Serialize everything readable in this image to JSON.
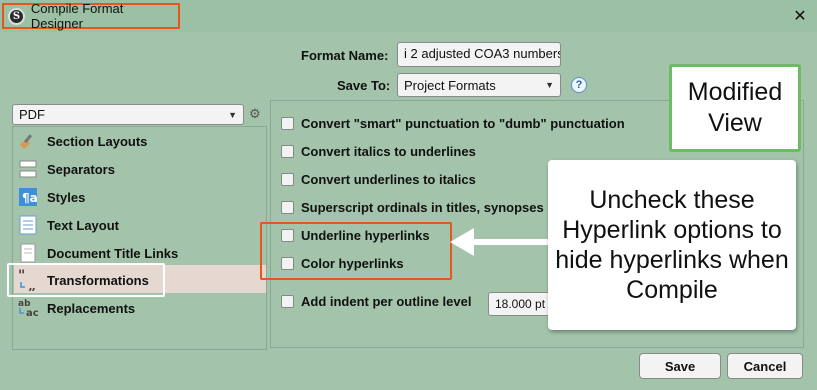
{
  "window": {
    "title": "Compile Format Designer",
    "close_glyph": "✕",
    "app_icon_letter": "S"
  },
  "header": {
    "format_name_label": "Format Name:",
    "format_name_value": "i 2 adjusted COA3 numbers",
    "save_to_label": "Save To:",
    "save_to_value": "Project Formats",
    "help_glyph": "?"
  },
  "left": {
    "output_type": "PDF",
    "gear_glyph": "⚙",
    "items": [
      {
        "label": "Section Layouts",
        "icon": "paintbrush-icon"
      },
      {
        "label": "Separators",
        "icon": "separator-icon"
      },
      {
        "label": "Styles",
        "icon": "styles-icon"
      },
      {
        "label": "Text Layout",
        "icon": "text-layout-icon"
      },
      {
        "label": "Document Title Links",
        "icon": "document-icon"
      },
      {
        "label": "Transformations",
        "icon": "quote-transform-icon"
      },
      {
        "label": "Replacements",
        "icon": "ab-ac-replace-icon"
      }
    ],
    "selected": "Transformations"
  },
  "options": [
    {
      "label": "Convert \"smart\" punctuation to \"dumb\" punctuation",
      "checked": false
    },
    {
      "label": "Convert italics to underlines",
      "checked": false
    },
    {
      "label": "Convert underlines to italics",
      "checked": false
    },
    {
      "label": "Superscript ordinals in titles, synopses &",
      "checked": false
    },
    {
      "label": "Underline hyperlinks",
      "checked": false
    },
    {
      "label": "Color hyperlinks",
      "checked": false
    },
    {
      "label": "Add indent per outline level",
      "checked": false
    }
  ],
  "indent_value": "18.000 pt",
  "callouts": {
    "modified_view": "Modified View",
    "instruction": "Uncheck these Hyperlink options to hide hyperlinks when Compile"
  },
  "buttons": {
    "save": "Save",
    "cancel": "Cancel"
  },
  "colors": {
    "background": "#a3c4ab",
    "highlight_border": "#e8551e",
    "callout_border": "#6dbb63",
    "selected_row": "#e5d8d0"
  }
}
